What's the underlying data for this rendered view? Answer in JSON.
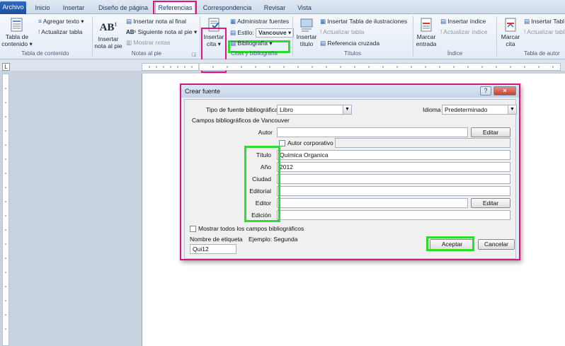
{
  "tabs": [
    "Archivo",
    "Inicio",
    "Insertar",
    "Diseño de página",
    "Referencias",
    "Correspondencia",
    "Revisar",
    "Vista"
  ],
  "ribbon": {
    "toc": {
      "table_label_1": "Tabla de",
      "table_label_2": "contenido",
      "add_text": "Agregar texto",
      "update_table": "Actualizar tabla",
      "group_label": "Tabla de contenido"
    },
    "footnotes": {
      "ab_icon": "AB",
      "insert_footnote_1": "Insertar",
      "insert_footnote_2": "nota al pie",
      "insert_endnote": "Insertar nota al final",
      "next_footnote": "Siguiente nota al pie",
      "show_notes": "Mostrar notas",
      "group_label": "Notas al pie"
    },
    "citations": {
      "insert_citation_1": "Insertar",
      "insert_citation_2": "cita",
      "manage_sources": "Administrar fuentes",
      "style_label": "Estilo:",
      "style_value": "Vancouve",
      "bibliography": "Bibliografía",
      "group_label": "Citas y bibliografía"
    },
    "captions": {
      "insert_caption_1": "Insertar",
      "insert_caption_2": "título",
      "insert_table_figures": "Insertar Tabla de ilustraciones",
      "update_table": "Actualizar tabla",
      "cross_reference": "Referencia cruzada",
      "group_label": "Títulos"
    },
    "index": {
      "mark_entry_1": "Marcar",
      "mark_entry_2": "entrada",
      "insert_index": "Insertar índice",
      "update_index": "Actualizar índice",
      "group_label": "Índice"
    },
    "authorities": {
      "mark_citation_1": "Marcar",
      "mark_citation_2": "cita",
      "insert_table": "Insertar Tabl",
      "update_table": "Actualizar tabl",
      "group_label": "Tabla de autor"
    }
  },
  "dialog": {
    "title": "Crear fuente",
    "help": "?",
    "close": "×",
    "source_type_label": "Tipo de fuente bibliográfica",
    "source_type_value": "Libro",
    "language_label": "Idioma",
    "language_value": "Predeterminado",
    "fields_heading": "Campos bibliográficos de Vancouver",
    "author_label": "Autor",
    "author_value": "",
    "edit_label": "Editar",
    "corporate_author_label": "Autor corporativo",
    "fields": [
      {
        "label": "Título",
        "value": "Química Organica"
      },
      {
        "label": "Año",
        "value": "2012"
      },
      {
        "label": "Ciudad",
        "value": ""
      },
      {
        "label": "Editorial",
        "value": ""
      },
      {
        "label": "Editor",
        "value": ""
      },
      {
        "label": "Edición",
        "value": ""
      }
    ],
    "show_all_label": "Mostrar todos los campos bibliográficos",
    "tag_name_label": "Nombre de etiqueta",
    "tag_name_value": "Qui12",
    "example_label": "Ejemplo: Segunda",
    "ok_label": "Aceptar",
    "cancel_label": "Cancelar"
  }
}
